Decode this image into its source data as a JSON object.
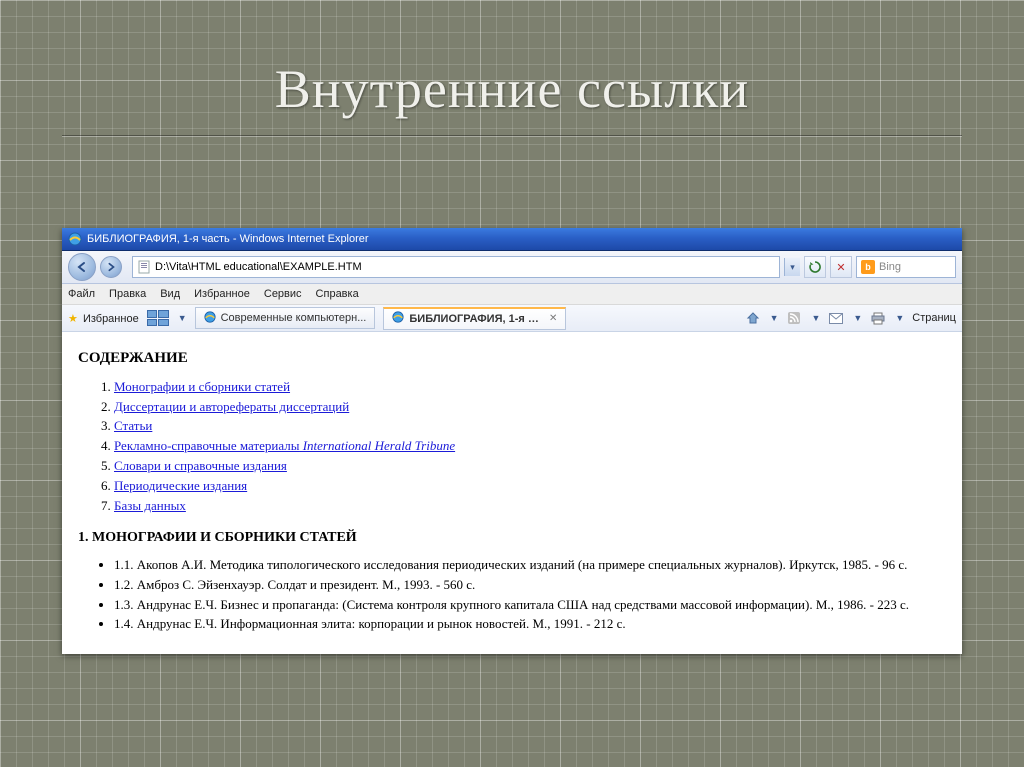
{
  "slide": {
    "title": "Внутренние ссылки"
  },
  "browser": {
    "window_title": "БИБЛИОГРАФИЯ, 1-я часть - Windows Internet Explorer",
    "address": "D:\\Vita\\HTML educational\\EXAMPLE.HTM",
    "search_placeholder": "Bing",
    "menus": [
      "Файл",
      "Правка",
      "Вид",
      "Избранное",
      "Сервис",
      "Справка"
    ],
    "favorites_label": "Избранное",
    "right_link_label": "Страниц",
    "tabs": [
      {
        "label": "Современные компьютерн...",
        "active": false
      },
      {
        "label": "БИБЛИОГРАФИЯ, 1-я ча...",
        "active": true
      }
    ]
  },
  "page": {
    "toc_heading": "СОДЕРЖАНИЕ",
    "toc": [
      {
        "text": "Монографии и сборники статей"
      },
      {
        "text": "Диссертации и авторефераты диссертаций"
      },
      {
        "text": "Статьи"
      },
      {
        "text": "Рекламно-справочные материалы",
        "italic_suffix": " International Herald Tribune"
      },
      {
        "text": "Словари и справочные издания"
      },
      {
        "text": "Периодические издания"
      },
      {
        "text": "Базы данных"
      }
    ],
    "section1_heading": "1. МОНОГРАФИИ И СБОРНИКИ СТАТЕЙ",
    "entries": [
      "1.1. Акопов А.И. Методика типологического исследования периодических изданий (на примере специальных журналов). Иркутск, 1985. - 96 с.",
      "1.2. Амброз С. Эйзенхауэр. Солдат и президент. М., 1993. - 560 с.",
      "1.3. Андрунас Е.Ч. Бизнес и пропаганда: (Система контроля крупного капитала США над средствами массовой информации). М., 1986. - 223 с.",
      "1.4. Андрунас Е.Ч. Информационная элита: корпорации и рынок новостей. М., 1991. - 212 с."
    ]
  }
}
